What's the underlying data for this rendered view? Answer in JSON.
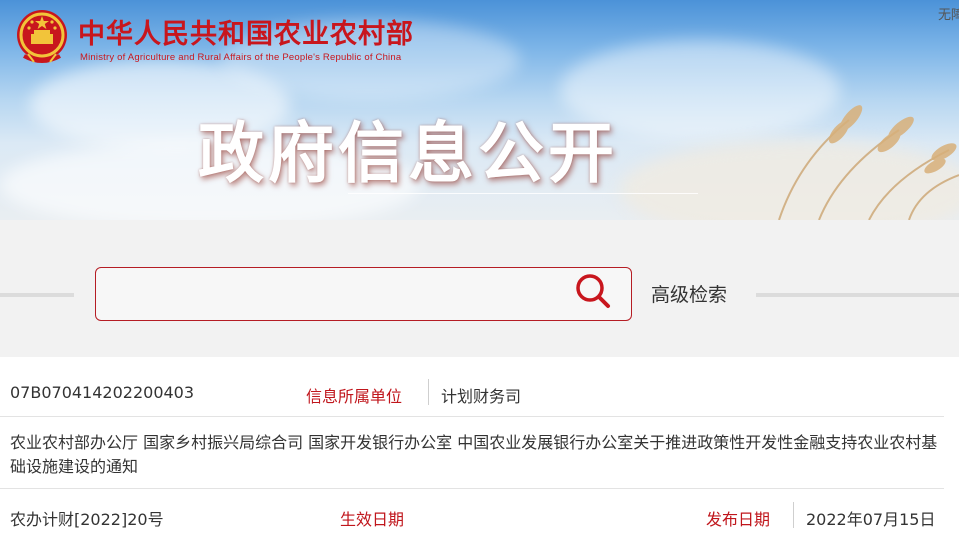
{
  "header": {
    "ministry_cn": "中华人民共和国农业农村部",
    "ministry_en": "Ministry of Agriculture and Rural Affairs of the People's Republic of China",
    "corner_text": "无障",
    "banner_title": "政府信息公开",
    "emblem_icon": "national-emblem-icon"
  },
  "search": {
    "placeholder": "",
    "value": "",
    "icon": "search-icon",
    "advanced_label": "高级检索"
  },
  "document": {
    "index_number": "07B070414202200403",
    "unit_label": "信息所属单位",
    "unit_value": "计划财务司",
    "title": "农业农村部办公厅 国家乡村振兴局综合司 国家开发银行办公室 中国农业发展银行办公室关于推进政策性开发性金融支持农业农村基础设施建设的通知",
    "doc_number": "农办计财[2022]20号",
    "effective_label": "生效日期",
    "effective_value": "",
    "publish_label": "发布日期",
    "publish_value": "2022年07月15日"
  },
  "colors": {
    "brand_red": "#c8161d",
    "label_red": "#c0161c",
    "search_border": "#b51d24"
  }
}
